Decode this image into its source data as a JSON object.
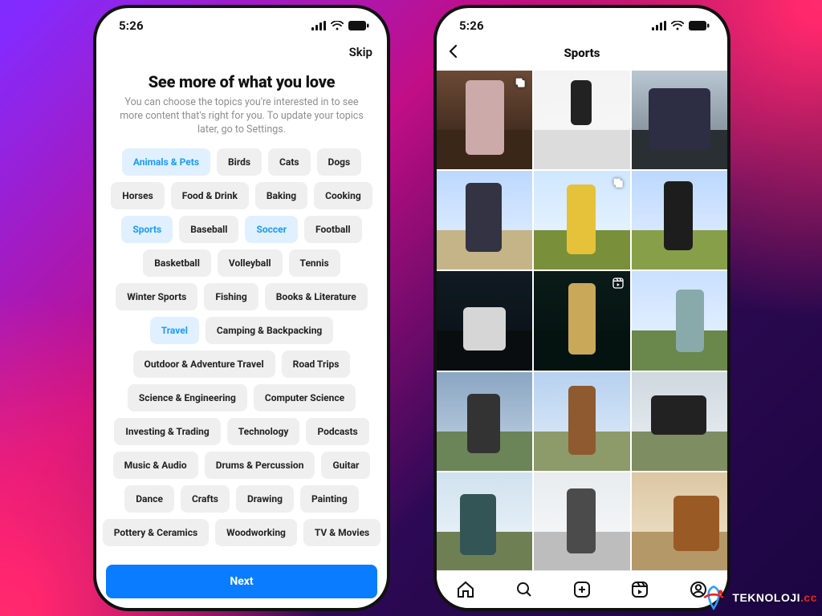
{
  "status": {
    "time": "5:26"
  },
  "topics_screen": {
    "skip": "Skip",
    "title": "See more of what you love",
    "subtitle": "You can choose the topics you're interested in to see more content that's right for you. To update your topics later, go to Settings.",
    "next": "Next",
    "chips": [
      {
        "label": "Animals & Pets",
        "selected": true
      },
      {
        "label": "Birds"
      },
      {
        "label": "Cats"
      },
      {
        "label": "Dogs"
      },
      {
        "label": "Horses"
      },
      {
        "label": "Food & Drink"
      },
      {
        "label": "Baking"
      },
      {
        "label": "Cooking"
      },
      {
        "label": "Sports",
        "selected": true
      },
      {
        "label": "Baseball"
      },
      {
        "label": "Soccer",
        "selected": true
      },
      {
        "label": "Football"
      },
      {
        "label": "Basketball"
      },
      {
        "label": "Volleyball"
      },
      {
        "label": "Tennis"
      },
      {
        "label": "Winter Sports"
      },
      {
        "label": "Fishing"
      },
      {
        "label": "Books & Literature"
      },
      {
        "label": "Travel",
        "selected": true
      },
      {
        "label": "Camping & Backpacking"
      },
      {
        "label": "Outdoor & Adventure Travel"
      },
      {
        "label": "Road Trips"
      },
      {
        "label": "Science & Engineering"
      },
      {
        "label": "Computer Science"
      },
      {
        "label": "Investing & Trading"
      },
      {
        "label": "Technology"
      },
      {
        "label": "Podcasts"
      },
      {
        "label": "Music & Audio"
      },
      {
        "label": "Drums & Percussion"
      },
      {
        "label": "Guitar"
      },
      {
        "label": "Dance"
      },
      {
        "label": "Crafts"
      },
      {
        "label": "Drawing"
      },
      {
        "label": "Painting"
      },
      {
        "label": "Pottery & Ceramics"
      },
      {
        "label": "Woodworking"
      },
      {
        "label": "TV & Movies"
      }
    ]
  },
  "feed_screen": {
    "title": "Sports",
    "tiles": [
      {
        "badge": "carousel"
      },
      {
        "badge": null
      },
      {
        "badge": null
      },
      {
        "badge": null
      },
      {
        "badge": "carousel"
      },
      {
        "badge": null
      },
      {
        "badge": null
      },
      {
        "badge": "reel"
      },
      {
        "badge": null
      },
      {
        "badge": null
      },
      {
        "badge": null
      },
      {
        "badge": null
      },
      {
        "badge": null
      },
      {
        "badge": null
      },
      {
        "badge": null
      }
    ]
  },
  "watermark": {
    "brand": "TEKNOLOJI",
    "suffix": ".cc"
  }
}
